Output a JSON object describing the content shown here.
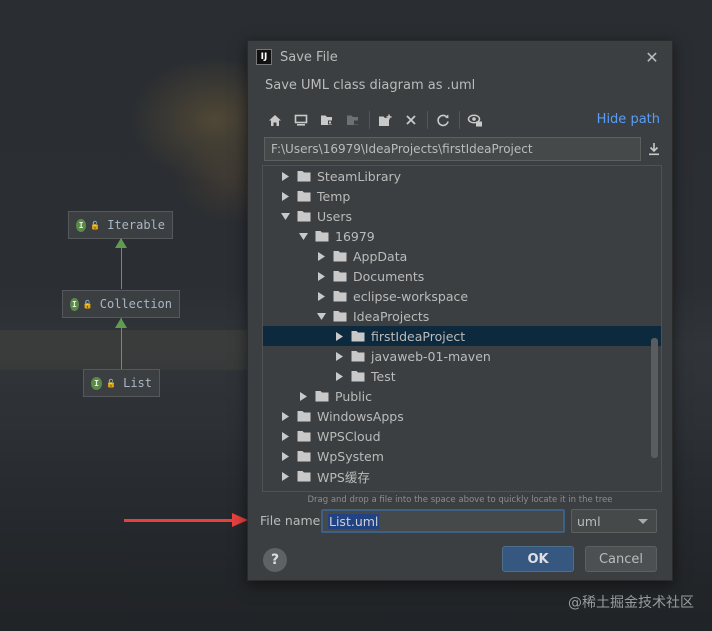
{
  "background": {
    "uml_nodes": [
      {
        "name": "Iterable",
        "badge": "I"
      },
      {
        "name": "Collection",
        "badge": "I"
      },
      {
        "name": "List",
        "badge": "I"
      }
    ],
    "watermark": "@稀土掘金技术社区"
  },
  "dialog": {
    "title": "Save File",
    "app_icon": "IJ",
    "close_icon": "close-icon",
    "description": "Save UML class diagram as .uml",
    "toolbar": {
      "icons": [
        "home-icon",
        "desktop-icon",
        "project-folder-icon",
        "module-folder-icon",
        "new-folder-icon",
        "delete-icon",
        "refresh-icon",
        "show-hidden-icon"
      ],
      "hide_path_label": "Hide path"
    },
    "path": "F:\\Users\\16979\\IdeaProjects\\firstIdeaProject",
    "tree": [
      {
        "label": "SteamLibrary",
        "level": 0,
        "expanded": false,
        "selected": false
      },
      {
        "label": "Temp",
        "level": 0,
        "expanded": false,
        "selected": false
      },
      {
        "label": "Users",
        "level": 0,
        "expanded": true,
        "selected": false
      },
      {
        "label": "16979",
        "level": 1,
        "expanded": true,
        "selected": false
      },
      {
        "label": "AppData",
        "level": 2,
        "expanded": false,
        "selected": false
      },
      {
        "label": "Documents",
        "level": 2,
        "expanded": false,
        "selected": false
      },
      {
        "label": "eclipse-workspace",
        "level": 2,
        "expanded": false,
        "selected": false
      },
      {
        "label": "IdeaProjects",
        "level": 2,
        "expanded": true,
        "selected": false
      },
      {
        "label": "firstIdeaProject",
        "level": 3,
        "expanded": false,
        "selected": true
      },
      {
        "label": "javaweb-01-maven",
        "level": 3,
        "expanded": false,
        "selected": false
      },
      {
        "label": "Test",
        "level": 3,
        "expanded": false,
        "selected": false
      },
      {
        "label": "Public",
        "level": 1,
        "expanded": false,
        "selected": false
      },
      {
        "label": "WindowsApps",
        "level": 0,
        "expanded": false,
        "selected": false
      },
      {
        "label": "WPSCloud",
        "level": 0,
        "expanded": false,
        "selected": false
      },
      {
        "label": "WpSystem",
        "level": 0,
        "expanded": false,
        "selected": false
      },
      {
        "label": "WPS缓存",
        "level": 0,
        "expanded": false,
        "selected": false
      }
    ],
    "hint": "Drag and drop a file into the space above to quickly locate it in the tree",
    "file_name_label": "File name:",
    "file_name_value": "List.uml",
    "extension": "uml",
    "help_label": "?",
    "ok_label": "OK",
    "cancel_label": "Cancel"
  },
  "colors": {
    "accent_link": "#589df6",
    "selection": "#0d293e",
    "ok_button": "#365880",
    "annotation_arrow": "#e8403f",
    "uml_edge": "#5f9c52"
  }
}
